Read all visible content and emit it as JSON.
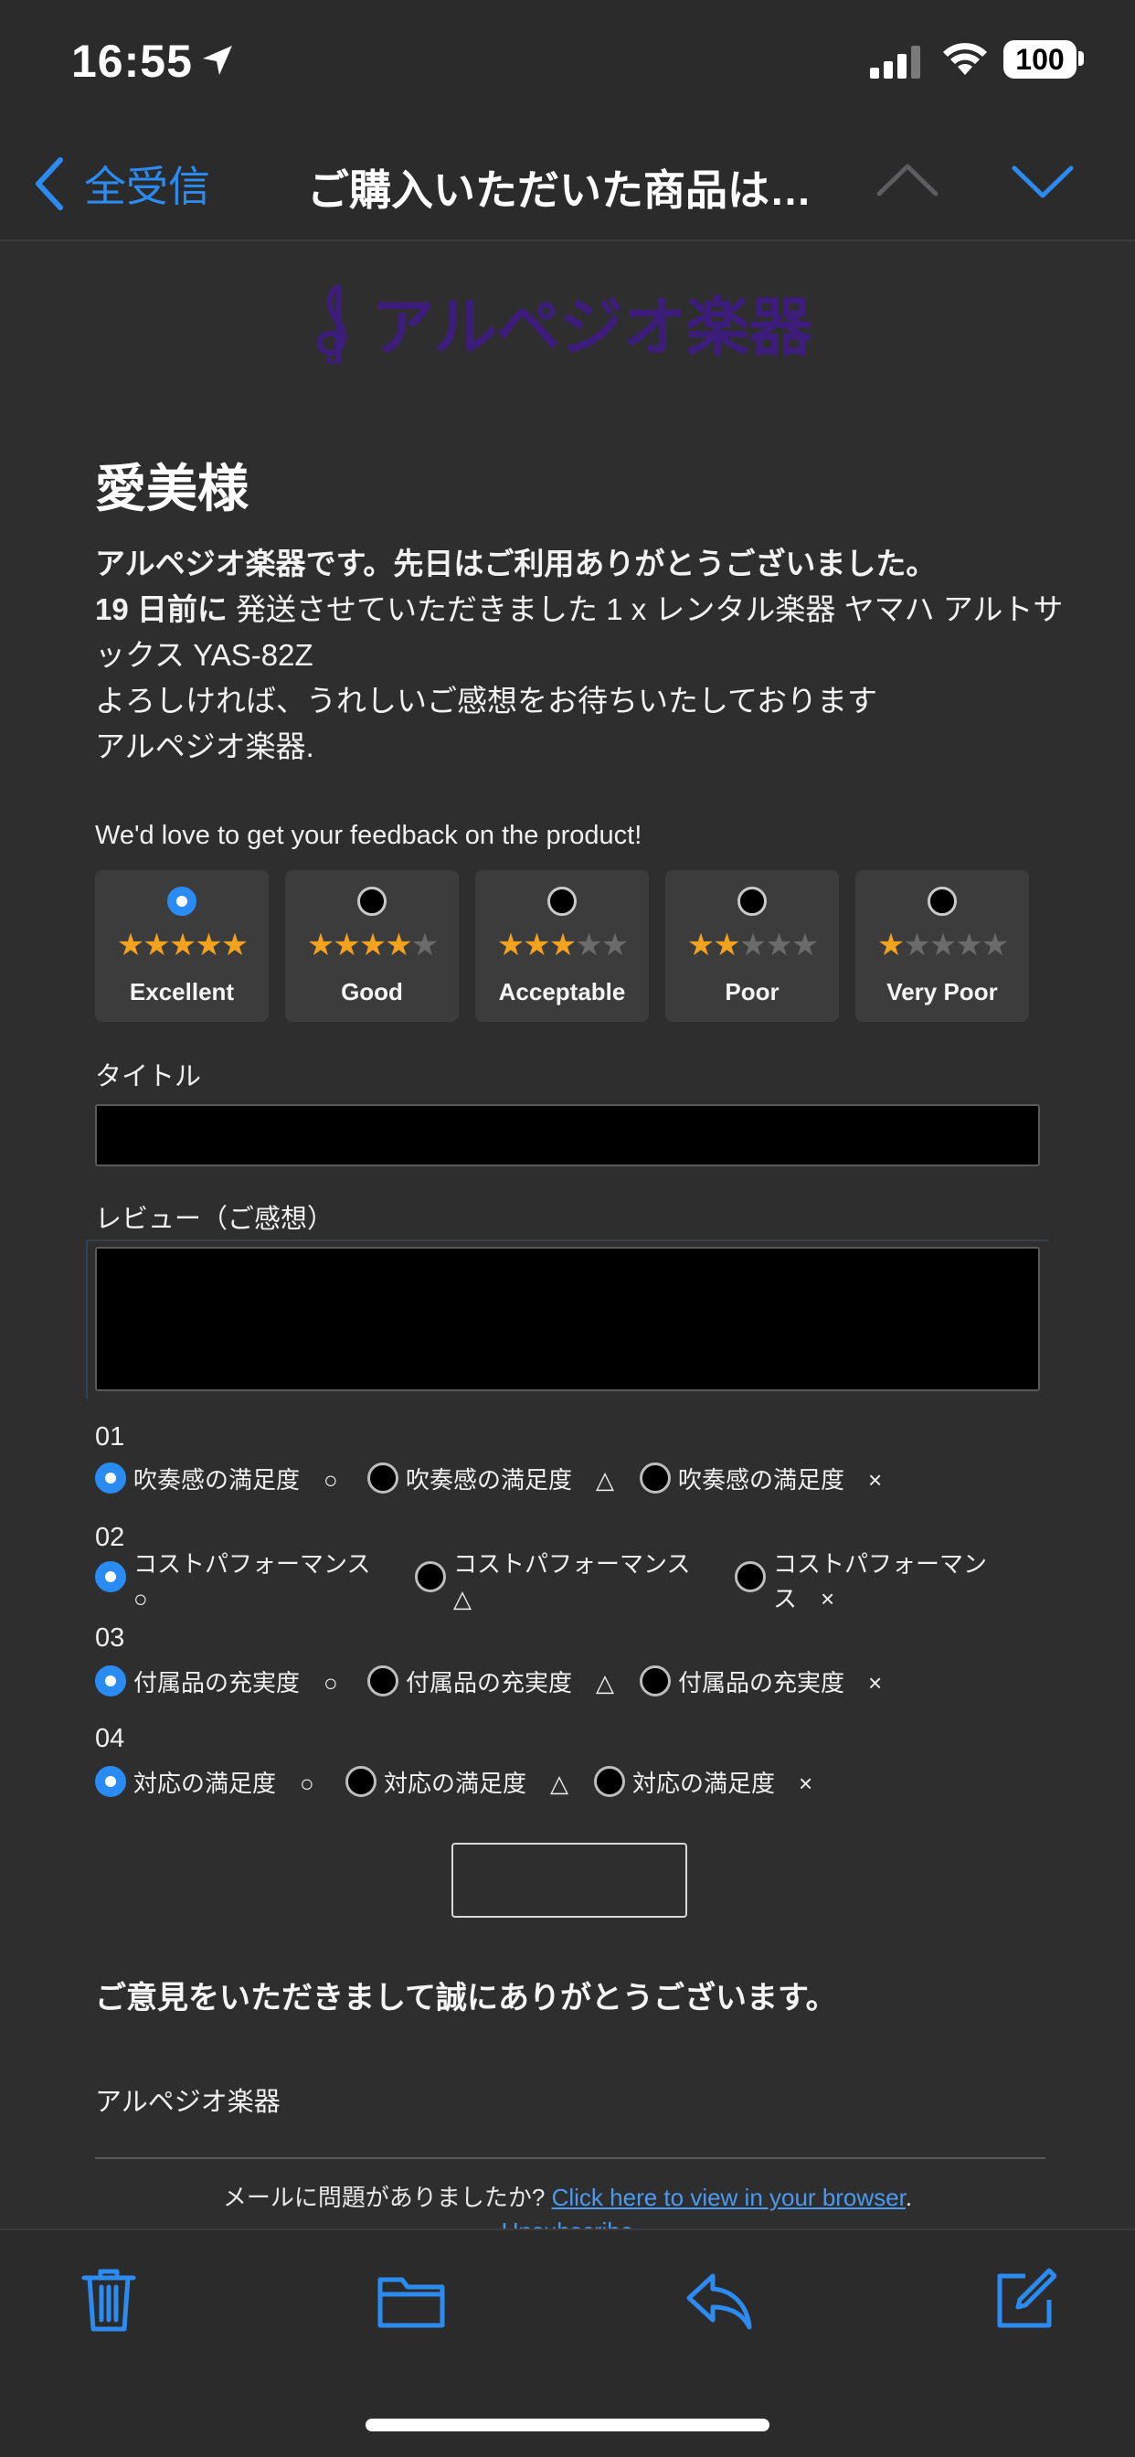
{
  "status_bar": {
    "time": "16:55",
    "battery": "100"
  },
  "nav": {
    "back_label": "全受信",
    "title": "ご購入いただいた商品は…"
  },
  "email": {
    "logo_text": "アルペジオ楽器",
    "greeting": "愛美様",
    "intro_line1": "アルペジオ楽器です。先日はご利用ありがとうございました。",
    "intro_days": "19 日前に",
    "intro_line2": " 発送させていただきました 1 x レンタル楽器 ヤマハ アルトサックス YAS-82Z",
    "intro_line3": "よろしければ、うれしいご感想をお待ちいたしております",
    "intro_line4": "アルペジオ楽器.",
    "feedback_title": "We'd love to get your feedback on the product!",
    "ratings": [
      {
        "label": "Excellent",
        "stars": 5,
        "selected": true
      },
      {
        "label": "Good",
        "stars": 4,
        "selected": false
      },
      {
        "label": "Acceptable",
        "stars": 3,
        "selected": false
      },
      {
        "label": "Poor",
        "stars": 2,
        "selected": false
      },
      {
        "label": "Very Poor",
        "stars": 1,
        "selected": false
      }
    ],
    "title_label": "タイトル",
    "review_label": "レビュー（ご感想）",
    "questions": [
      {
        "num": "01",
        "options": [
          "吹奏感の満足度　○",
          "吹奏感の満足度　△",
          "吹奏感の満足度　×"
        ]
      },
      {
        "num": "02",
        "options": [
          "コストパフォーマンス\n○",
          "コストパフォーマンス\n△",
          "コストパフォーマン\nス　×"
        ]
      },
      {
        "num": "03",
        "options": [
          "付属品の充実度　○",
          "付属品の充実度　△",
          "付属品の充実度　×"
        ]
      },
      {
        "num": "04",
        "options": [
          "対応の満足度　○",
          "対応の満足度　△",
          "対応の満足度　×"
        ]
      }
    ],
    "thanks": "ご意見をいただきまして誠にありがとうございます。",
    "signoff": "アルペジオ楽器",
    "footer_text": "メールに問題がありましたか? ",
    "footer_link": "Click here to view in your browser",
    "footer_period": ".",
    "unsubscribe": "Unsubscribe"
  },
  "toolbar": {
    "icons": [
      "trash-icon",
      "folder-icon",
      "reply-icon",
      "compose-icon"
    ]
  },
  "colors": {
    "accent": "#2c8bf0",
    "star": "#f2a21c",
    "logo": "#3d1d7c"
  }
}
